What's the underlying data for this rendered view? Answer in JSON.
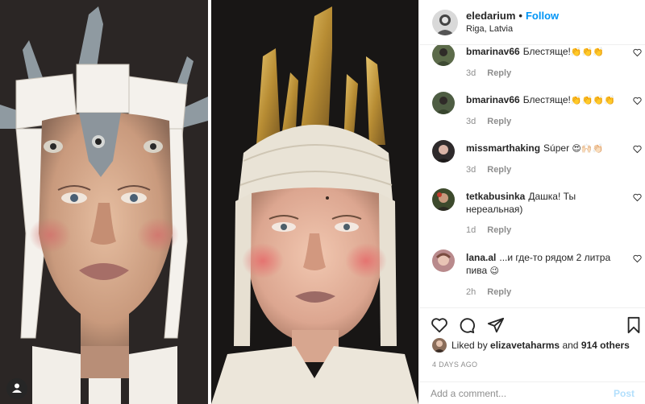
{
  "header": {
    "username": "eledarium",
    "separator": "•",
    "follow_label": "Follow",
    "location": "Riga, Latvia"
  },
  "comments": [
    {
      "user": "bmarinav66",
      "text": "Блестяще!",
      "emoji": "👏👏👏",
      "time": "3d",
      "reply": "Reply",
      "avatar_color": "#5c6b4a"
    },
    {
      "user": "bmarinav66",
      "text": "Блестяще!",
      "emoji": "👏👏👏👏",
      "time": "3d",
      "reply": "Reply",
      "avatar_color": "#4e5d43"
    },
    {
      "user": "missmarthaking",
      "text": "Súper",
      "emoji": "😍🙌🏻👏🏻",
      "time": "3d",
      "reply": "Reply",
      "avatar_color": "#2e2a2b"
    },
    {
      "user": "tetkabusinka",
      "text": "Дашка! Ты нереальная)",
      "emoji": "",
      "time": "1d",
      "reply": "Reply",
      "avatar_color": "#3d4a2c"
    },
    {
      "user": "lana.al",
      "text": "...и где-то рядом 2 литра пива",
      "emoji": "😉",
      "time": "2h",
      "reply": "Reply",
      "avatar_color": "#b98a8c"
    }
  ],
  "likes": {
    "prefix": "Liked by",
    "user": "elizavetaharms",
    "middle": "and",
    "count": "914 others"
  },
  "date": "4 DAYS AGO",
  "add_comment": {
    "placeholder": "Add a comment...",
    "post_label": "Post"
  },
  "icons": {
    "like": "heart-icon",
    "comment": "comment-icon",
    "share": "share-icon",
    "save": "bookmark-icon",
    "tag": "user-tag-icon"
  },
  "colors": {
    "accent": "#0095f6",
    "post_disabled": "#b2dffc",
    "muted": "#8e8e8e",
    "text": "#262626"
  }
}
